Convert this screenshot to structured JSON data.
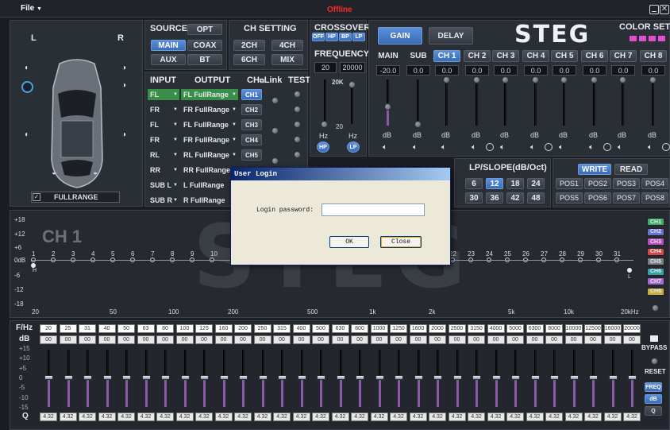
{
  "menu": {
    "file": "File",
    "status": "Offline"
  },
  "brand": {
    "logo": "STEG"
  },
  "car": {
    "left": "L",
    "right": "R",
    "mode": "FULLRANGE"
  },
  "source": {
    "title": "SOURCE",
    "buttons": [
      "OPT",
      "MAIN",
      "COAX",
      "AUX",
      "BT"
    ],
    "active": "MAIN"
  },
  "ch_setting": {
    "title": "CH SETTING",
    "buttons": [
      "2CH",
      "4CH",
      "6CH",
      "MIX"
    ]
  },
  "routing": {
    "headers": {
      "input": "INPUT",
      "output": "OUTPUT",
      "ch": "CH",
      "link": "Link",
      "test": "TEST"
    },
    "rows": [
      {
        "input": "FL",
        "output": "FL FullRange",
        "ch": "CH1",
        "active": true
      },
      {
        "input": "FR",
        "output": "FR FullRange",
        "ch": "CH2",
        "active": false
      },
      {
        "input": "FL",
        "output": "FL FullRange",
        "ch": "CH3",
        "active": false
      },
      {
        "input": "FR",
        "output": "FR FullRange",
        "ch": "CH4",
        "active": false
      },
      {
        "input": "RL",
        "output": "RL FullRange",
        "ch": "CH5",
        "active": false
      },
      {
        "input": "RR",
        "output": "RR FullRange",
        "ch": "",
        "active": false
      },
      {
        "input": "SUB L",
        "output": "L FullRange",
        "ch": "",
        "active": false
      },
      {
        "input": "SUB R",
        "output": "R FullRange",
        "ch": "",
        "active": false
      }
    ]
  },
  "crossover": {
    "title": "CROSSOVER",
    "modes": [
      "OFF",
      "HP",
      "BP",
      "LP"
    ],
    "active_mode": "OFF",
    "frequency_label": "FREQUENCY",
    "freq_low": "20",
    "freq_high": "20000",
    "hp_top": "20K",
    "hp_mid": "20",
    "hz1": "Hz",
    "hz2": "Hz",
    "hp": "HP",
    "lp": "LP"
  },
  "gain": {
    "tabs": [
      "GAIN",
      "DELAY"
    ],
    "active_tab": "GAIN",
    "channels": [
      "MAIN",
      "SUB",
      "CH 1",
      "CH 2",
      "CH 3",
      "CH 4",
      "CH 5",
      "CH 6",
      "CH 7",
      "CH 8"
    ],
    "values": [
      "-20.0",
      "0.0",
      "0.0",
      "0.0",
      "0.0",
      "0.0",
      "0.0",
      "0.0",
      "0.0",
      "0.0"
    ],
    "unit": "dB"
  },
  "color_set": {
    "title": "COLOR SET",
    "swatches": [
      "#e04fd0",
      "#e04fd0",
      "#e04fd0",
      "#e04fd0"
    ]
  },
  "slope": {
    "title": "LP/SLOPE(dB/Oct)",
    "values": [
      "6",
      "12",
      "18",
      "24",
      "30",
      "36",
      "42",
      "48"
    ],
    "active": "12"
  },
  "presets": {
    "write": "WRITE",
    "read": "READ",
    "positions": [
      "POS1",
      "POS2",
      "POS3",
      "POS4",
      "POS5",
      "POS6",
      "POS7",
      "POS8"
    ]
  },
  "graph": {
    "title": "CH 1",
    "ylabels": [
      "+18",
      "+12",
      "+6",
      "0dB",
      "-6",
      "-12",
      "-18"
    ],
    "xlabels": [
      "20",
      "50",
      "100",
      "200",
      "500",
      "1k",
      "2k",
      "5k",
      "10k",
      "20kHz"
    ],
    "points_left": [
      "1",
      "2",
      "3",
      "4",
      "5",
      "6",
      "7",
      "8",
      "9",
      "10"
    ],
    "points_right": [
      "22",
      "23",
      "24",
      "25",
      "26",
      "27",
      "28",
      "29",
      "30",
      "31"
    ],
    "h_label": "H",
    "l_label": "L",
    "channel_buttons": [
      "CH1",
      "CH2",
      "CH3",
      "CH4",
      "CH5",
      "CH6",
      "CH7",
      "CH8"
    ],
    "channel_colors": [
      "#3fae6a",
      "#6a72d0",
      "#b84fc0",
      "#d44848",
      "#7a7f88",
      "#3aa0a8",
      "#a06ad0",
      "#c8b040"
    ]
  },
  "eq": {
    "freq_label": "F/Hz",
    "db_label": "dB",
    "q_label": "Q",
    "freqs": [
      "20",
      "25",
      "31",
      "40",
      "50",
      "63",
      "80",
      "100",
      "125",
      "160",
      "200",
      "250",
      "315",
      "400",
      "500",
      "630",
      "800",
      "1000",
      "1250",
      "1600",
      "2000",
      "2500",
      "3150",
      "4000",
      "5000",
      "6300",
      "8000",
      "10000",
      "12500",
      "16000",
      "20000"
    ],
    "db_value": "00",
    "q_value": "4.32",
    "scale": [
      "+15",
      "+10",
      "+5",
      "0",
      "-5",
      "-10",
      "-15"
    ],
    "side": {
      "bypass": "BYPASS",
      "reset": "RESET",
      "freq": "FREQ",
      "db": "dB",
      "q": "Q"
    }
  },
  "login": {
    "title": "User Login",
    "label": "Login password:",
    "value": "",
    "ok": "OK",
    "close": "Close"
  }
}
